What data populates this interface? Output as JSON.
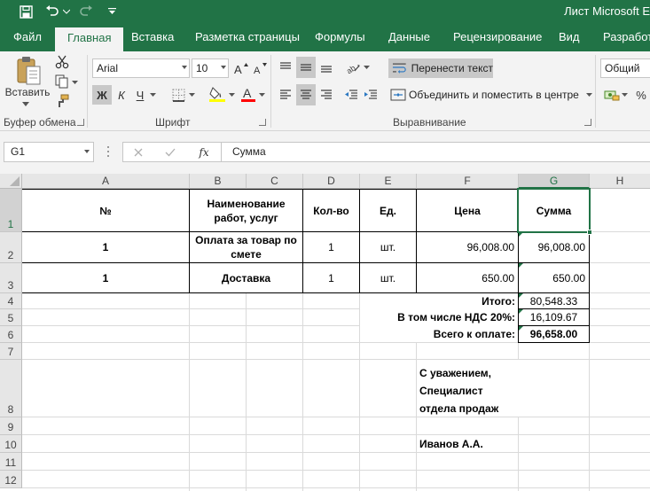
{
  "titlebar": {
    "title": "Лист Microsoft E"
  },
  "tabs": [
    "Файл",
    "Главная",
    "Вставка",
    "Разметка страницы",
    "Формулы",
    "Данные",
    "Рецензирование",
    "Вид",
    "Разработч"
  ],
  "ribbon": {
    "clipboard": {
      "paste_label": "Вставить",
      "group_label": "Буфер обмена"
    },
    "font": {
      "font_name": "Arial",
      "font_size": "10",
      "bold": "Ж",
      "italic": "К",
      "underline": "Ч",
      "group_label": "Шрифт"
    },
    "alignment": {
      "wrap_text": "Перенести текст",
      "merge_center": "Объединить и поместить в центре",
      "group_label": "Выравнивание"
    },
    "number": {
      "format": "Общий",
      "percent": "%"
    }
  },
  "formula_bar": {
    "name_box": "G1",
    "fx": "fx",
    "formula": "Сумма"
  },
  "columns": [
    "A",
    "B",
    "C",
    "D",
    "E",
    "F",
    "G",
    "H"
  ],
  "rows": [
    "1",
    "2",
    "3",
    "4",
    "5",
    "6",
    "7",
    "8",
    "9",
    "10",
    "11",
    "12"
  ],
  "sheet": {
    "header": {
      "num": "№",
      "name": "Наименование работ, услуг",
      "qty": "Кол-во",
      "unit": "Ед.",
      "price": "Цена",
      "sum": "Сумма"
    },
    "items": [
      {
        "num": "1",
        "name": "Оплата за товар по смете",
        "qty": "1",
        "unit": "шт.",
        "price": "96,008.00",
        "sum": "96,008.00"
      },
      {
        "num": "1",
        "name": "Доставка",
        "qty": "1",
        "unit": "шт.",
        "price": "650.00",
        "sum": "650.00"
      }
    ],
    "totals": [
      {
        "label": "Итого:",
        "value": "80,548.33"
      },
      {
        "label": "В том числе НДС 20%:",
        "value": "16,109.67"
      },
      {
        "label": "Всего к оплате:",
        "value": "96,658.00"
      }
    ],
    "signature": {
      "line1": "С уважением,",
      "line2": "Специалист",
      "line3": "отдела продаж",
      "name": "Иванов А.А."
    }
  }
}
